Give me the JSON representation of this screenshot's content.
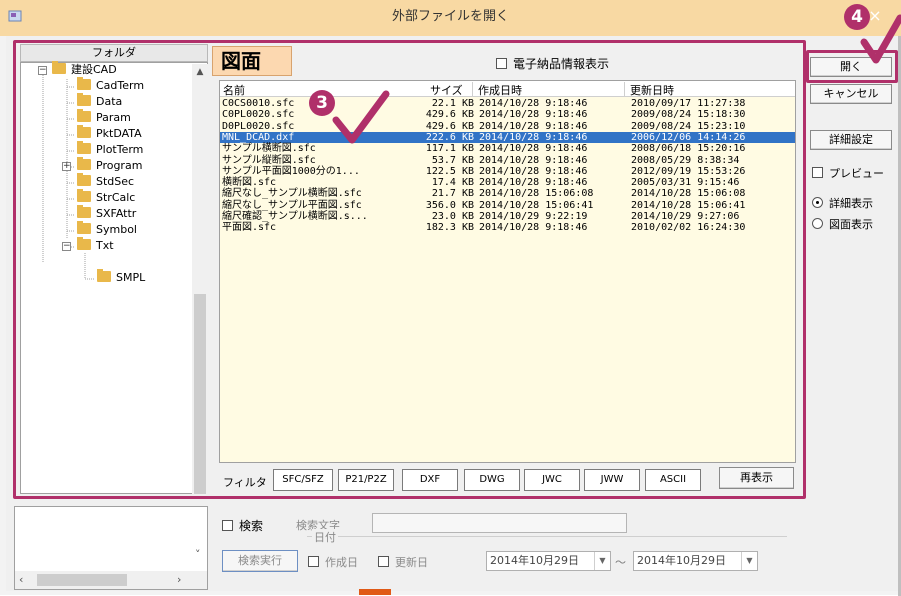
{
  "window": {
    "title": "外部ファイルを開く",
    "close_label": "×"
  },
  "folder_pane": {
    "header": "フォルダ",
    "items": [
      {
        "label": "建設CAD"
      },
      {
        "label": "CadTerm"
      },
      {
        "label": "Data"
      },
      {
        "label": "Param"
      },
      {
        "label": "PktDATA"
      },
      {
        "label": "PlotTerm"
      },
      {
        "label": "Program"
      },
      {
        "label": "StdSec"
      },
      {
        "label": "StrCalc"
      },
      {
        "label": "SXFAttr"
      },
      {
        "label": "Symbol"
      },
      {
        "label": "Txt"
      },
      {
        "label": "SMPL"
      }
    ]
  },
  "main": {
    "section_title": "図面",
    "electronic_delivery_check": "電子納品情報表示",
    "columns": {
      "name": "名前",
      "size": "サイズ",
      "created": "作成日時",
      "updated": "更新日時"
    },
    "files": [
      {
        "name": "C0CS0010.sfc",
        "size": "22.1 KB",
        "created": "2014/10/28 9:18:46",
        "updated": "2010/09/17 11:27:38"
      },
      {
        "name": "C0PL0020.sfc",
        "size": "429.6 KB",
        "created": "2014/10/28 9:18:46",
        "updated": "2009/08/24 15:18:30"
      },
      {
        "name": "D0PL0020.sfc",
        "size": "429.6 KB",
        "created": "2014/10/28 9:18:46",
        "updated": "2009/08/24 15:23:10"
      },
      {
        "name": "MNL_DCAD.dxf",
        "size": "222.6 KB",
        "created": "2014/10/28 9:18:46",
        "updated": "2006/12/06 14:14:26"
      },
      {
        "name": "サンプル横断図.sfc",
        "size": "117.1 KB",
        "created": "2014/10/28 9:18:46",
        "updated": "2008/06/18 15:20:16"
      },
      {
        "name": "サンプル縦断図.sfc",
        "size": "53.7 KB",
        "created": "2014/10/28 9:18:46",
        "updated": "2008/05/29 8:38:34"
      },
      {
        "name": "サンプル平面図1000分の1...",
        "size": "122.5 KB",
        "created": "2014/10/28 9:18:46",
        "updated": "2012/09/19 15:53:26"
      },
      {
        "name": "横断図.sfc",
        "size": "17.4 KB",
        "created": "2014/10/28 9:18:46",
        "updated": "2005/03/31 9:15:46"
      },
      {
        "name": "縮尺なし_サンプル横断図.sfc",
        "size": "21.7 KB",
        "created": "2014/10/28 15:06:08",
        "updated": "2014/10/28 15:06:08"
      },
      {
        "name": "縮尺なし_サンプル平面図.sfc",
        "size": "356.0 KB",
        "created": "2014/10/28 15:06:41",
        "updated": "2014/10/28 15:06:41"
      },
      {
        "name": "縮尺確認_サンプル横断図.s...",
        "size": "23.0 KB",
        "created": "2014/10/29 9:22:19",
        "updated": "2014/10/29 9:27:06"
      },
      {
        "name": "平面図.sfc",
        "size": "182.3 KB",
        "created": "2014/10/28 9:18:46",
        "updated": "2010/02/02 16:24:30"
      }
    ],
    "selected_index": 3
  },
  "filter": {
    "label": "フィルタ",
    "buttons": [
      "SFC/SFZ",
      "P21/P2Z",
      "DXF",
      "DWG",
      "JWC",
      "JWW",
      "ASCII"
    ],
    "refresh": "再表示"
  },
  "side": {
    "open": "開く",
    "cancel": "キャンセル",
    "details": "詳細設定",
    "preview": "プレビュー",
    "detail_view": "詳細表示",
    "drawing_view": "図面表示"
  },
  "search": {
    "check": "検索",
    "text_label": "検索文字",
    "date_legend": "日付",
    "run": "検索実行",
    "created": "作成日",
    "updated": "更新日",
    "date_from": "2014年10月29日",
    "tilde": "～",
    "date_to": "2014年10月29日"
  },
  "callouts": {
    "step3": "3",
    "step4": "4"
  },
  "colors": {
    "accent": "#b0306a",
    "selection": "#3173c6",
    "title_bar": "#f8d9a3",
    "list_bg": "#fffbe3"
  }
}
